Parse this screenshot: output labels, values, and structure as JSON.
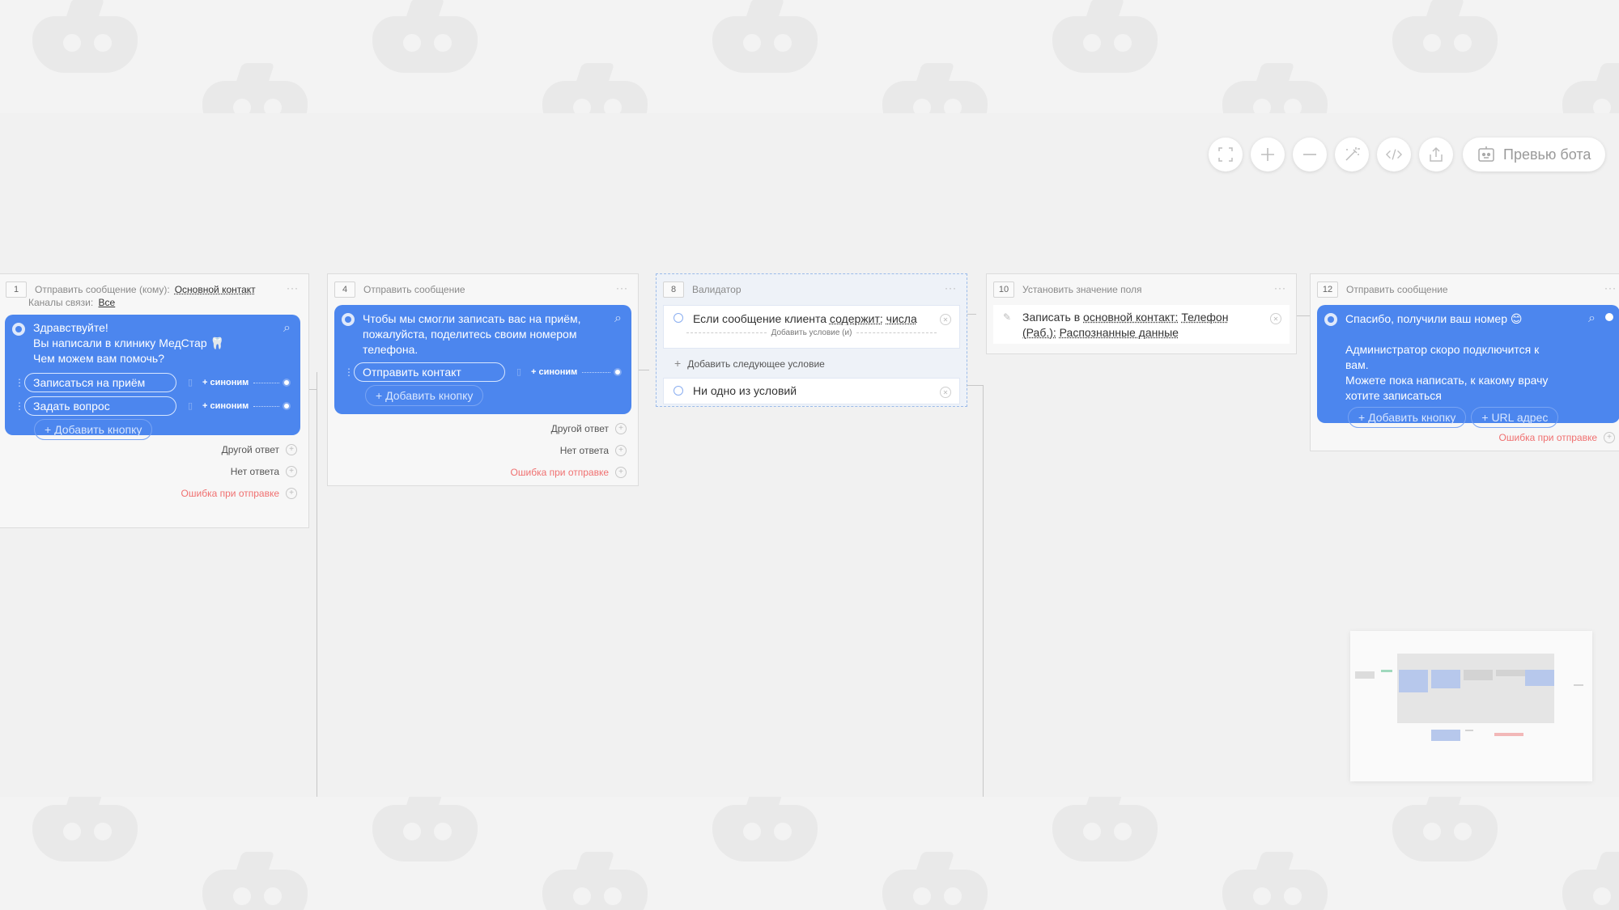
{
  "toolbar": {
    "preview_label": "Превью бота",
    "buttons": [
      "fullscreen-icon",
      "zoom-in-icon",
      "zoom-out-icon",
      "magic-wand-icon",
      "code-icon",
      "export-icon"
    ]
  },
  "blocks": [
    {
      "num": "1",
      "title": "Отправить сообщение (кому):",
      "recipient": "Основной контакт",
      "channels_label": "Каналы связи:",
      "channels_value": "Все",
      "message": "Здравствуйте!\nВы написали в клинику МедСтар 🦷\nЧем можем вам помочь?",
      "buttons": [
        {
          "label": "Записаться на приём",
          "synonym": "+ синоним"
        },
        {
          "label": "Задать вопрос",
          "synonym": "+ синоним"
        }
      ],
      "add_button": "Добавить кнопку",
      "outputs": [
        "Другой ответ",
        "Нет ответа",
        "Ошибка при отправке"
      ]
    },
    {
      "num": "4",
      "title": "Отправить сообщение",
      "message": "Чтобы мы смогли записать вас на приём, пожалуйста, поделитесь своим номером телефона.",
      "buttons": [
        {
          "label": "Отправить контакт",
          "synonym": "+ синоним"
        }
      ],
      "add_button": "Добавить кнопку",
      "outputs": [
        "Другой ответ",
        "Нет ответа",
        "Ошибка при отправке"
      ]
    },
    {
      "num": "8",
      "title": "Валидатор",
      "condition_prefix": "Если сообщение клиента",
      "condition_op": "содержит:",
      "condition_value": "числа",
      "add_and": "Добавить условие (и)",
      "add_next": "Добавить следующее условие",
      "none": "Ни одно из условий"
    },
    {
      "num": "10",
      "title": "Установить значение поля",
      "action_prefix": "Записать в",
      "action_target": "основной контакт:",
      "action_field": "Телефон (Раб.):",
      "action_value": "Распознанные данные"
    },
    {
      "num": "12",
      "title": "Отправить сообщение",
      "message_first": "Спасибо, получили ваш номер 😊",
      "message_rest": "Администратор скоро подключится к вам.\nМожете пока написать, к какому врачу хотите записаться",
      "add_button": "Добавить кнопку",
      "url_button": "URL адрес",
      "outputs": [
        "Ошибка при отправке"
      ]
    }
  ],
  "colors": {
    "message_bg": "#4c86ee",
    "error_text": "#f07070",
    "canvas_bg": "#f1f1f1"
  }
}
